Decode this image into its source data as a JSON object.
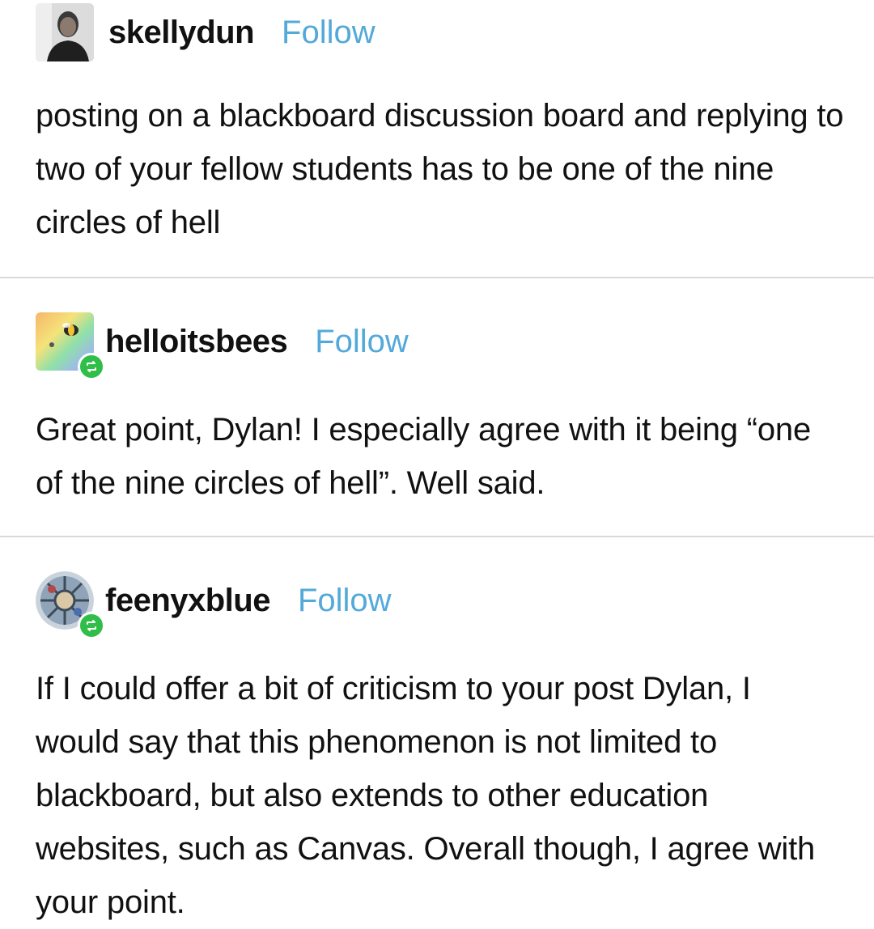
{
  "posts": [
    {
      "username": "skellydun",
      "follow_label": "Follow",
      "text": "posting on a blackboard discussion board and replying to two of your fellow students has to be one of the nine circles of hell"
    },
    {
      "username": "helloitsbees",
      "follow_label": "Follow",
      "text": "Great point, Dylan! I especially agree with it being “one of the nine circles of hell”. Well said."
    },
    {
      "username": "feenyxblue",
      "follow_label": "Follow",
      "text": "If I could offer a bit of criticism to your post Dylan, I would say that this phenomenon is not limited to blackboard, but also extends to other education websites, such as Canvas. Overall though, I agree with your point."
    }
  ],
  "colors": {
    "follow": "#53a9da",
    "reblog_badge": "#2fbf48",
    "divider": "#d9d9d9"
  },
  "icons": {
    "avatar_1": "person-photo-avatar",
    "avatar_2": "rainbow-bee-avatar",
    "avatar_3": "stained-glass-avatar",
    "reblog": "reblog-icon"
  }
}
